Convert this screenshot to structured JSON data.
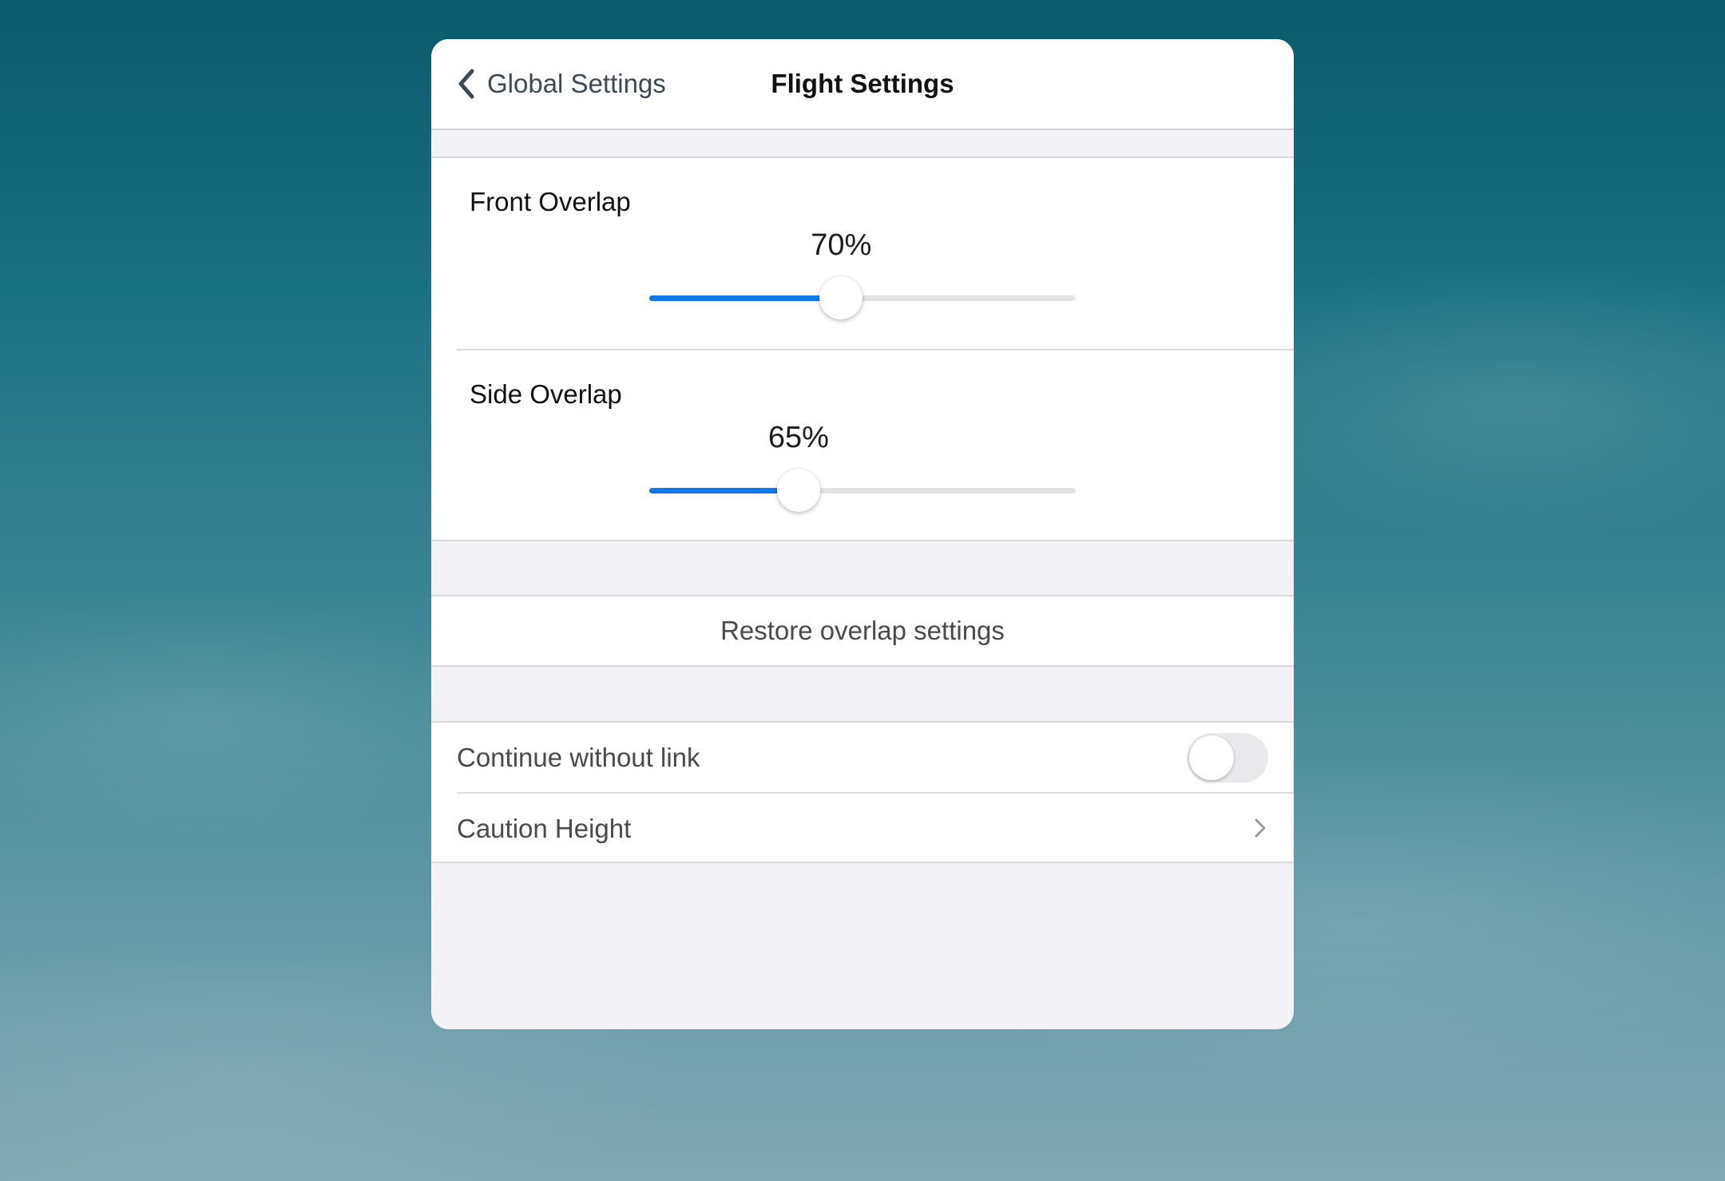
{
  "navigation": {
    "back_label": "Global Settings",
    "title": "Flight Settings"
  },
  "overlap": {
    "front": {
      "label": "Front Overlap",
      "value_text": "70%",
      "slider_fraction": 0.45
    },
    "side": {
      "label": "Side Overlap",
      "value_text": "65%",
      "slider_fraction": 0.35
    }
  },
  "restore": {
    "label": "Restore overlap settings"
  },
  "options": {
    "continue_without_link": {
      "label": "Continue without link",
      "enabled": false
    },
    "caution_height": {
      "label": "Caution Height"
    }
  },
  "colors": {
    "accent": "#1277e8",
    "track": "#e3e3e6",
    "group_background": "#f2f2f7"
  },
  "icons": {
    "back": "chevron-left-icon",
    "disclosure": "chevron-right-icon"
  }
}
